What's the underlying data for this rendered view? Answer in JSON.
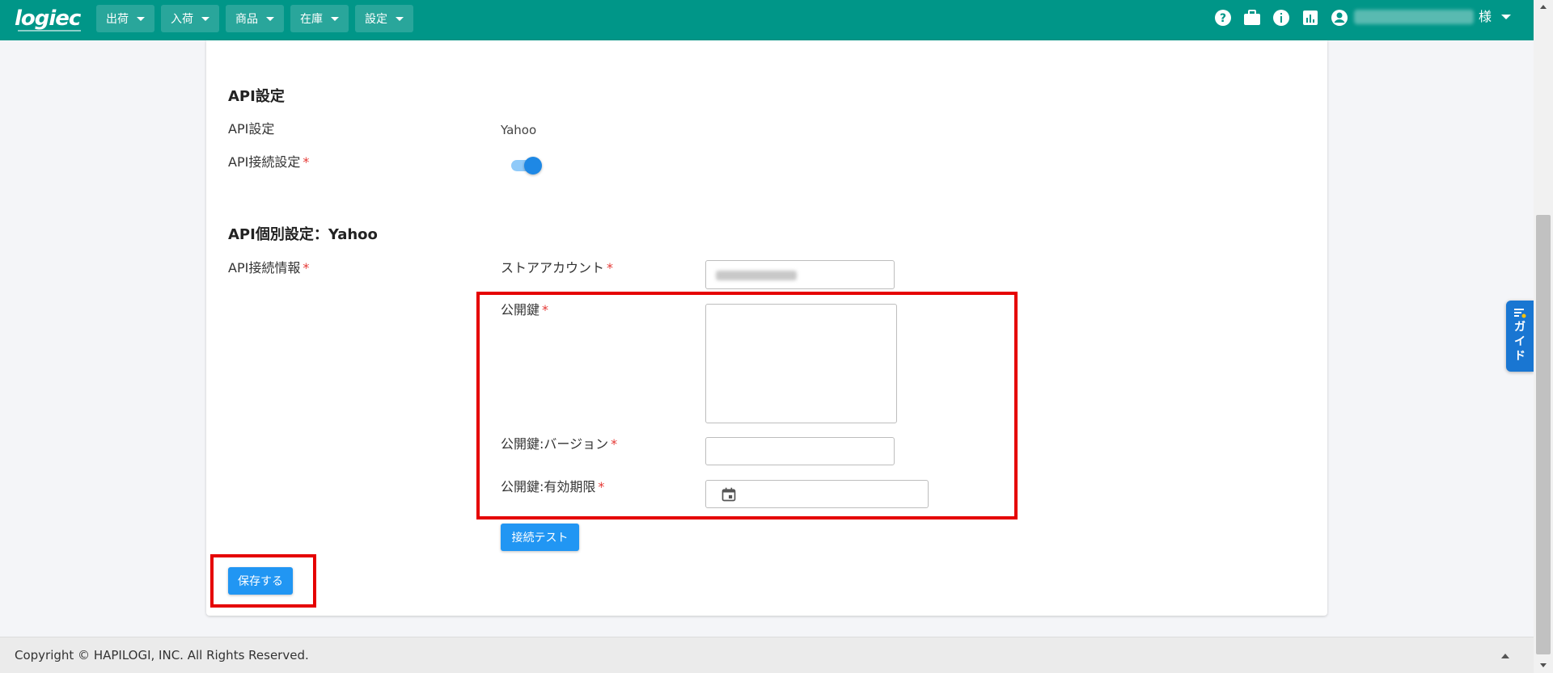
{
  "header": {
    "logo": "logiec",
    "nav": [
      {
        "label": "出荷"
      },
      {
        "label": "入荷"
      },
      {
        "label": "商品"
      },
      {
        "label": "在庫"
      },
      {
        "label": "設定"
      }
    ],
    "user_suffix": "様",
    "icons": [
      "help-icon",
      "briefcase-icon",
      "info-icon",
      "chart-icon",
      "account-icon"
    ]
  },
  "api_section": {
    "title": "API設定",
    "api_setting_label": "API設定",
    "api_setting_value": "Yahoo",
    "connection_label": "API接続設定",
    "connection_required": "*",
    "connection_enabled": true
  },
  "individual_section": {
    "title": "API個別設定：Yahoo",
    "info_label": "API接続情報",
    "info_required": "*",
    "store_account_label": "ストアアカウント",
    "store_account_required": "*",
    "public_key_label": "公開鍵",
    "public_key_required": "*",
    "public_key_version_label": "公開鍵:バージョン",
    "public_key_version_required": "*",
    "public_key_expiry_label": "公開鍵:有効期限",
    "public_key_expiry_required": "*",
    "test_button": "接続テスト"
  },
  "actions": {
    "save_button": "保存する"
  },
  "guide": {
    "label": "ガイド"
  },
  "footer": {
    "copyright": "Copyright © HAPILOGI, INC. All Rights Reserved."
  },
  "colors": {
    "brand": "#009688",
    "primary": "#2196f3",
    "highlight": "#e50000",
    "required": "#e53935"
  }
}
